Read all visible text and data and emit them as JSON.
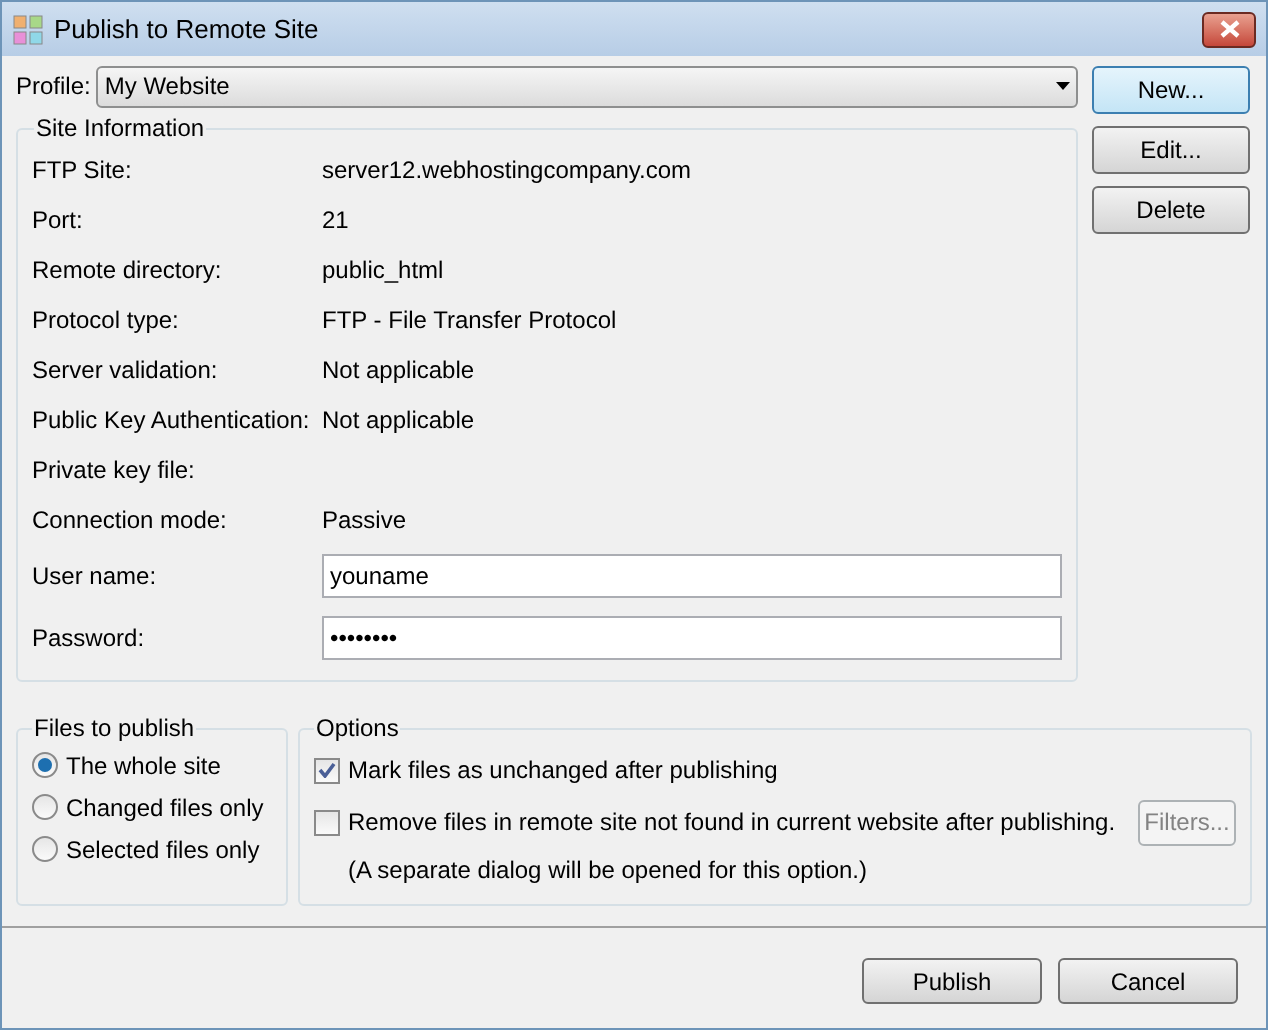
{
  "window": {
    "title": "Publish to Remote Site"
  },
  "profile": {
    "label": "Profile:",
    "value": "My Website"
  },
  "profile_buttons": [
    {
      "label": "New...",
      "focused": true
    },
    {
      "label": "Edit...",
      "focused": false
    },
    {
      "label": "Delete",
      "focused": false
    }
  ],
  "site_information": {
    "title": "Site Information",
    "rows": [
      {
        "kind": "text",
        "label": "FTP Site:",
        "value": "server12.webhostingcompany.com"
      },
      {
        "kind": "text",
        "label": "Port:",
        "value": "21"
      },
      {
        "kind": "text",
        "label": "Remote directory:",
        "value": "public_html"
      },
      {
        "kind": "text",
        "label": "Protocol type:",
        "value": "FTP - File Transfer Protocol"
      },
      {
        "kind": "text",
        "label": "Server validation:",
        "value": "Not applicable"
      },
      {
        "kind": "text",
        "label": "Public Key Authentication:",
        "value": "Not applicable"
      },
      {
        "kind": "text",
        "label": "Private key file:"
      },
      {
        "kind": "text",
        "label": "Connection mode:",
        "value": "Passive"
      },
      {
        "kind": "input",
        "label": "User name:",
        "value": "youname"
      },
      {
        "kind": "input",
        "label": "Password:",
        "value": "••••••••"
      }
    ]
  },
  "files_to_publish": {
    "title": "Files to publish",
    "options": [
      {
        "label": "The whole site",
        "selected": true
      },
      {
        "label": "Changed files only",
        "selected": false
      },
      {
        "label": "Selected files only",
        "selected": false
      }
    ]
  },
  "options": {
    "title": "Options",
    "items": [
      {
        "label": "Mark files as unchanged after publishing",
        "checked": true
      },
      {
        "label": "Remove files in remote site not found in current website after publishing.",
        "checked": false
      }
    ],
    "filters_button": {
      "label": "Filters...",
      "disabled": true
    },
    "note": "(A separate dialog will be opened for this option.)"
  },
  "buttons": [
    {
      "label": "Publish"
    },
    {
      "label": "Cancel"
    }
  ]
}
